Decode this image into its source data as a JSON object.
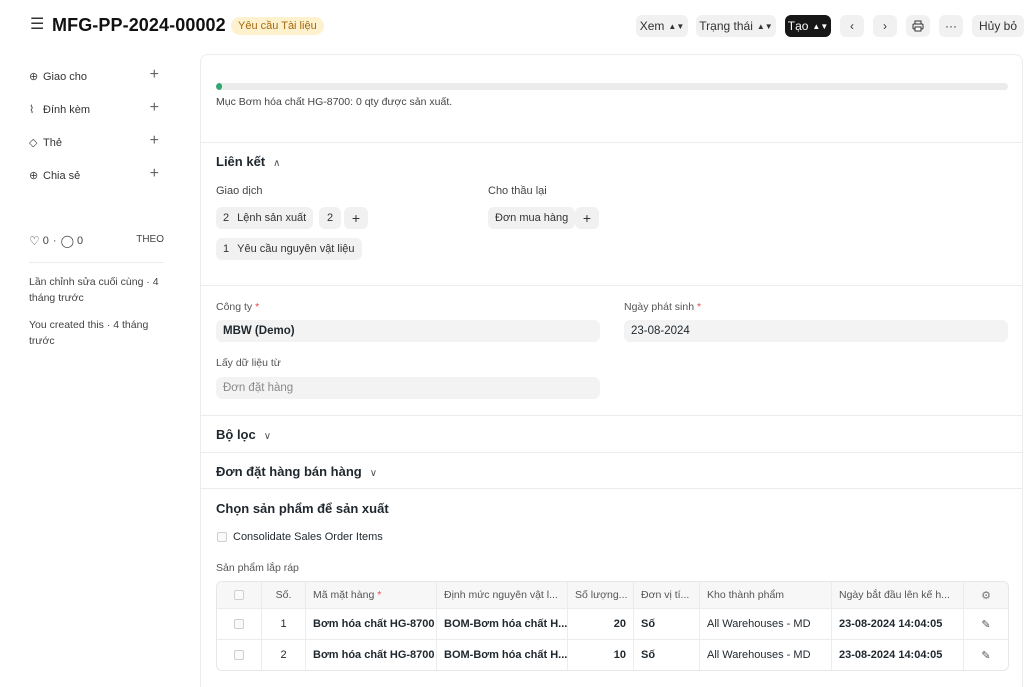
{
  "header": {
    "title": "MFG-PP-2024-00002",
    "status": "Yêu cầu Tài liệu",
    "buttons": {
      "view": "Xem",
      "status": "Trạng thái",
      "create": "Tạo",
      "cancel": "Hủy bỏ",
      "more": "···"
    }
  },
  "sidebar": {
    "items": [
      {
        "label": "Giao cho",
        "icon": "assign-icon"
      },
      {
        "label": "Đính kèm",
        "icon": "paperclip-icon"
      },
      {
        "label": "Thẻ",
        "icon": "tag-icon"
      },
      {
        "label": "Chia sẻ",
        "icon": "share-icon"
      }
    ],
    "likes": "0",
    "comments": "0",
    "follow": "THEO",
    "last_edit": "Lần chỉnh sửa cuối cùng · 4 tháng trước",
    "created": "You created this · 4 tháng trước"
  },
  "progress": {
    "fraction": 0.007,
    "text": "Mục Bơm hóa chất HG-8700: 0 qty được sản xuất."
  },
  "links": {
    "title": "Liên kết",
    "transactions_label": "Giao dịch",
    "subcontract_label": "Cho thầu lại",
    "work_order": {
      "count": "2",
      "label": "Lệnh sản xuất",
      "badge": "2"
    },
    "material_request": {
      "count": "1",
      "label": "Yêu cầu nguyên vật liệu"
    },
    "purchase_order": {
      "label": "Đơn mua hàng"
    }
  },
  "form": {
    "company_label": "Công ty",
    "company_value": "MBW (Demo)",
    "posting_date_label": "Ngày phát sinh",
    "posting_date_value": "23-08-2024",
    "get_items_label": "Lấy dữ liệu từ",
    "get_items_placeholder": "Đơn đặt hàng"
  },
  "sections": {
    "filters": "Bộ lọc",
    "sales_orders": "Đơn đặt hàng bán hàng",
    "select_items": "Chọn sản phẩm để sản xuất",
    "consolidate": "Consolidate Sales Order Items",
    "assembly_items": "Sản phẩm lắp ráp"
  },
  "table": {
    "headers": [
      "Số.",
      "Mã mặt hàng",
      "Định mức nguyên vật l...",
      "Số lượng...",
      "Đơn vị tí...",
      "Kho thành phẩm",
      "Ngày bắt đầu lên kế h..."
    ],
    "rows": [
      {
        "no": "1",
        "item": "Bơm hóa chất HG-8700",
        "bom": "BOM-Bơm hóa chất H...",
        "qty": "20",
        "uom": "Số",
        "warehouse": "All Warehouses - MD",
        "date": "23-08-2024 14:04:05"
      },
      {
        "no": "2",
        "item": "Bơm hóa chất HG-8700",
        "bom": "BOM-Bơm hóa chất H...",
        "qty": "10",
        "uom": "Số",
        "warehouse": "All Warehouses - MD",
        "date": "23-08-2024 14:04:05"
      }
    ]
  },
  "colors": {
    "status_bg": "#fdf2cd",
    "status_text": "#a5670f",
    "progress": "#2fa86f",
    "primary_button": "#171717"
  }
}
